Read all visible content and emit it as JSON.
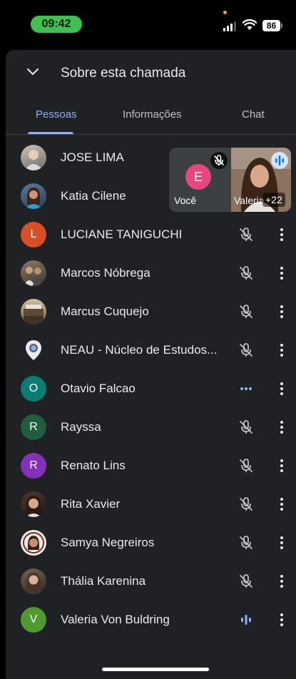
{
  "status_bar": {
    "time": "09:42",
    "battery": "86"
  },
  "sheet": {
    "title": "Sobre esta chamada"
  },
  "tabs": [
    {
      "label": "Pessoas",
      "active": true
    },
    {
      "label": "Informações",
      "active": false
    },
    {
      "label": "Chat",
      "active": false
    }
  ],
  "tiles": {
    "self": {
      "initial": "E",
      "label": "Você"
    },
    "featured": {
      "label": "Valeria",
      "count": "+22"
    }
  },
  "participants": [
    {
      "name": "JOSE LIMA",
      "avatar": "photo"
    },
    {
      "name": "Katia Cilene",
      "avatar": "photo"
    },
    {
      "name": "LUCIANE TANIGUCHI",
      "initial": "L",
      "color": "#d84f27",
      "status": "muted"
    },
    {
      "name": "Marcos Nóbrega",
      "avatar": "photo",
      "status": "muted"
    },
    {
      "name": "Marcus Cuquejo",
      "avatar": "photo",
      "status": "muted"
    },
    {
      "name": "NEAU - Núcleo de Estudos...",
      "avatar": "location-pin",
      "status": "muted"
    },
    {
      "name": "Otavio Falcao",
      "initial": "O",
      "color": "#0a7c72",
      "status": "connecting"
    },
    {
      "name": "Rayssa",
      "initial": "R",
      "color": "#1f5d3f",
      "status": "muted"
    },
    {
      "name": "Renato Lins",
      "initial": "R",
      "color": "#8332b8",
      "status": "muted"
    },
    {
      "name": "Rita Xavier",
      "avatar": "photo",
      "status": "muted"
    },
    {
      "name": "Samya Negreiros",
      "avatar": "photo",
      "status": "muted"
    },
    {
      "name": "Thália Karenina",
      "avatar": "photo",
      "status": "muted"
    },
    {
      "name": "Valeria Von Buldring",
      "initial": "V",
      "color": "#4e9a2f",
      "status": "speaking"
    }
  ],
  "colors": {
    "accent": "#8ab4f8",
    "sheet_bg": "#202124",
    "time_pill": "#3ec14f"
  }
}
